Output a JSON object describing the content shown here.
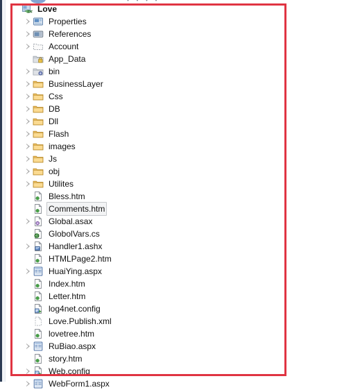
{
  "window": {
    "toolbar_fragment": "・  ・  ・  ・"
  },
  "annotation": {
    "color": "#e03442",
    "shape": "rectangle"
  },
  "solution_tree": {
    "root": {
      "label": "Love",
      "icon": "csharp-project-icon",
      "expander": "none",
      "bold": true
    },
    "items": [
      {
        "label": "Properties",
        "icon": "properties-icon",
        "expander": "collapsed",
        "selected": false
      },
      {
        "label": "References",
        "icon": "references-icon",
        "expander": "collapsed",
        "selected": false
      },
      {
        "label": "Account",
        "icon": "folder-excluded-icon",
        "expander": "collapsed",
        "selected": false
      },
      {
        "label": "App_Data",
        "icon": "folder-appdata-icon",
        "expander": "none",
        "selected": false
      },
      {
        "label": "bin",
        "icon": "folder-bin-icon",
        "expander": "collapsed",
        "selected": false
      },
      {
        "label": "BusinessLayer",
        "icon": "folder-icon",
        "expander": "collapsed",
        "selected": false
      },
      {
        "label": "Css",
        "icon": "folder-icon",
        "expander": "collapsed",
        "selected": false
      },
      {
        "label": "DB",
        "icon": "folder-icon",
        "expander": "collapsed",
        "selected": false
      },
      {
        "label": "Dll",
        "icon": "folder-icon",
        "expander": "collapsed",
        "selected": false
      },
      {
        "label": "Flash",
        "icon": "folder-icon",
        "expander": "collapsed",
        "selected": false
      },
      {
        "label": "images",
        "icon": "folder-icon",
        "expander": "collapsed",
        "selected": false
      },
      {
        "label": "Js",
        "icon": "folder-icon",
        "expander": "collapsed",
        "selected": false
      },
      {
        "label": "obj",
        "icon": "folder-icon",
        "expander": "collapsed",
        "selected": false
      },
      {
        "label": "Utilites",
        "icon": "folder-icon",
        "expander": "collapsed",
        "selected": false
      },
      {
        "label": "Bless.htm",
        "icon": "html-file-icon",
        "expander": "none",
        "selected": false
      },
      {
        "label": "Comments.htm",
        "icon": "html-file-icon",
        "expander": "none",
        "selected": true
      },
      {
        "label": "Global.asax",
        "icon": "asax-file-icon",
        "expander": "collapsed",
        "selected": false
      },
      {
        "label": "GlobolVars.cs",
        "icon": "csharp-file-icon",
        "expander": "none",
        "selected": false
      },
      {
        "label": "Handler1.ashx",
        "icon": "ashx-file-icon",
        "expander": "collapsed",
        "selected": false
      },
      {
        "label": "HTMLPage2.htm",
        "icon": "html-file-icon",
        "expander": "none",
        "selected": false
      },
      {
        "label": "HuaiYing.aspx",
        "icon": "aspx-file-icon",
        "expander": "collapsed",
        "selected": false
      },
      {
        "label": "Index.htm",
        "icon": "html-file-icon",
        "expander": "none",
        "selected": false
      },
      {
        "label": "Letter.htm",
        "icon": "html-file-icon",
        "expander": "none",
        "selected": false
      },
      {
        "label": "log4net.config",
        "icon": "config-file-icon",
        "expander": "none",
        "selected": false
      },
      {
        "label": "Love.Publish.xml",
        "icon": "excluded-file-icon",
        "expander": "none",
        "selected": false
      },
      {
        "label": "lovetree.htm",
        "icon": "html-file-icon",
        "expander": "none",
        "selected": false
      },
      {
        "label": "RuBiao.aspx",
        "icon": "aspx-file-icon",
        "expander": "collapsed",
        "selected": false
      },
      {
        "label": "story.htm",
        "icon": "html-file-icon",
        "expander": "none",
        "selected": false
      },
      {
        "label": "Web.config",
        "icon": "config-file-icon",
        "expander": "collapsed",
        "selected": false
      },
      {
        "label": "WebForm1.aspx",
        "icon": "aspx-file-icon",
        "expander": "collapsed",
        "selected": false
      }
    ]
  }
}
